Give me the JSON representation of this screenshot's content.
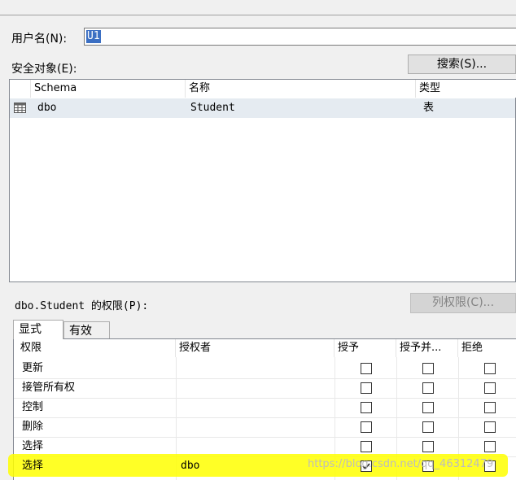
{
  "username": {
    "label": "用户名(N):",
    "value": "U1"
  },
  "securables": {
    "label": "安全对象(E):",
    "search_button": "搜索(S)...",
    "columns": [
      "Schema",
      "名称",
      "类型"
    ],
    "rows": [
      {
        "schema": "dbo",
        "name": "Student",
        "type": "表",
        "icon": "table-icon"
      }
    ]
  },
  "permissions": {
    "label": "dbo.Student 的权限(P):",
    "column_perms_button": "列权限(C)...",
    "tabs": [
      "显式",
      "有效"
    ],
    "columns": [
      "权限",
      "授权者",
      "授予",
      "授予并...",
      "拒绝"
    ],
    "rows": [
      {
        "permission": "更新",
        "grantor": "",
        "grant": false,
        "with_grant": false,
        "deny": false
      },
      {
        "permission": "接管所有权",
        "grantor": "",
        "grant": false,
        "with_grant": false,
        "deny": false
      },
      {
        "permission": "控制",
        "grantor": "",
        "grant": false,
        "with_grant": false,
        "deny": false
      },
      {
        "permission": "删除",
        "grantor": "",
        "grant": false,
        "with_grant": false,
        "deny": false
      },
      {
        "permission": "选择",
        "grantor": "",
        "grant": false,
        "with_grant": false,
        "deny": false
      },
      {
        "permission": "选择",
        "grantor": "dbo",
        "grant": true,
        "with_grant": false,
        "deny": false
      }
    ]
  },
  "watermark": "https://blog.csdn.net/qq_46312479",
  "colors": {
    "highlight": "#ffff00",
    "selection": "#3b6fc3",
    "row_selected": "#e5ebf1"
  }
}
